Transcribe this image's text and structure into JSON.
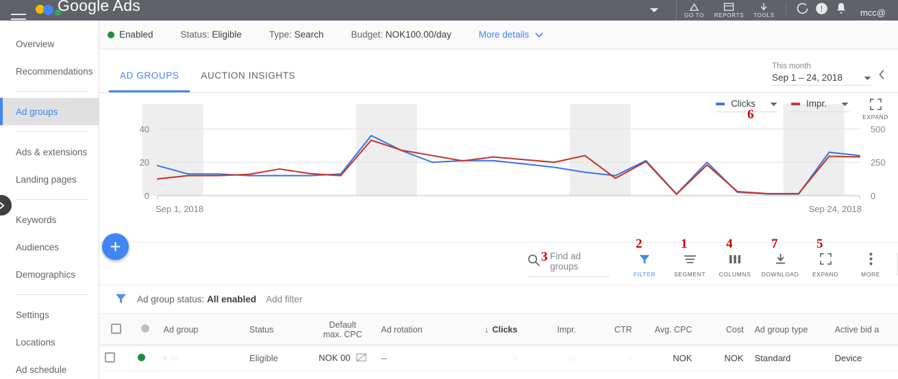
{
  "topbar": {
    "brand": "Google Ads",
    "menu_icon": "hamburger-icon",
    "account_caret": "chevron-down-icon",
    "tools": [
      {
        "label": "GO TO",
        "icon": "go-to-icon"
      },
      {
        "label": "REPORTS",
        "icon": "reports-icon"
      },
      {
        "label": "TOOLS",
        "icon": "tools-icon"
      }
    ],
    "refresh_icon": "refresh-icon",
    "help_icon": "help-icon",
    "notifications_icon": "bell-icon",
    "account": "mcc@"
  },
  "sidebar": {
    "items": [
      {
        "label": "Overview",
        "active": false
      },
      {
        "label": "Recommendations",
        "active": false
      },
      {
        "label": "Ad groups",
        "active": true
      },
      {
        "label": "Ads & extensions",
        "active": false
      },
      {
        "label": "Landing pages",
        "active": false
      },
      {
        "label": "Keywords",
        "active": false
      },
      {
        "label": "Audiences",
        "active": false
      },
      {
        "label": "Demographics",
        "active": false
      },
      {
        "label": "Settings",
        "active": false
      },
      {
        "label": "Locations",
        "active": false
      },
      {
        "label": "Ad schedule",
        "active": false
      }
    ],
    "expand_icon": "chevron-right-icon"
  },
  "statusbar": {
    "enabled_label": "Enabled",
    "status_label": "Status:",
    "status_value": "Eligible",
    "type_label": "Type:",
    "type_value": "Search",
    "budget_label": "Budget:",
    "budget_value": "NOK100.00/day",
    "more_details": "More details"
  },
  "tabs": [
    {
      "label": "AD GROUPS",
      "active": true
    },
    {
      "label": "AUCTION INSIGHTS",
      "active": false
    }
  ],
  "daterange": {
    "preset": "This month",
    "value": "Sep 1 – 24, 2018",
    "dropdown_icon": "caret-down-icon",
    "prev_icon": "chevron-left-icon"
  },
  "chart_legend": {
    "series1": {
      "label": "Clicks",
      "color": "#3b78e7"
    },
    "series2": {
      "label": "Impr.",
      "color": "#c5392e"
    },
    "expand_label": "EXPAND",
    "expand_icon": "expand-icon"
  },
  "toolbar": {
    "search_placeholder": "Find ad groups",
    "search_icon": "search-icon",
    "items": [
      {
        "label": "FILTER",
        "icon": "filter-icon",
        "active": true
      },
      {
        "label": "SEGMENT",
        "icon": "segment-icon",
        "active": false
      },
      {
        "label": "COLUMNS",
        "icon": "columns-icon",
        "active": false
      },
      {
        "label": "DOWNLOAD",
        "icon": "download-icon",
        "active": false
      },
      {
        "label": "EXPAND",
        "icon": "expand-icon",
        "active": false
      },
      {
        "label": "MORE",
        "icon": "more-vert-icon",
        "active": false
      }
    ]
  },
  "annotations": {
    "n1": "1",
    "n2": "2",
    "n3": "3",
    "n4": "4",
    "n5": "5",
    "n6": "6",
    "n7": "7",
    "color": "#cc0000"
  },
  "filterbar": {
    "filter_icon": "filter-icon",
    "chip_label": "Ad group status:",
    "chip_value": "All enabled",
    "add_filter": "Add filter"
  },
  "table": {
    "columns": [
      {
        "label": "",
        "key": "checkbox"
      },
      {
        "label": "",
        "key": "statusdot"
      },
      {
        "label": "Ad group",
        "key": "adgroup"
      },
      {
        "label": "Status",
        "key": "status"
      },
      {
        "label": "Default\nmax. CPC",
        "line1": "Default",
        "line2": "max. CPC",
        "key": "cpc"
      },
      {
        "label": "Ad rotation",
        "key": "rotation"
      },
      {
        "label": "Clicks",
        "key": "clicks",
        "sorted": true,
        "sort_icon": "arrow-down-icon"
      },
      {
        "label": "Impr.",
        "key": "impr"
      },
      {
        "label": "CTR",
        "key": "ctr"
      },
      {
        "label": "Avg. CPC",
        "key": "avgcpc"
      },
      {
        "label": "Cost",
        "key": "cost"
      },
      {
        "label": "Ad group type",
        "key": "type"
      },
      {
        "label": "Active bid a",
        "key": "activebid"
      }
    ],
    "rows": [
      {
        "status_dot": "enabled",
        "adgroup": "",
        "status": "Eligible",
        "cpc_currency": "NOK",
        "cpc_value": "00",
        "cpc_icon": "no-bid-icon",
        "rotation": "--",
        "clicks": "",
        "impr": "",
        "ctr": "",
        "avgcpc": "NOK",
        "cost": "NOK",
        "type": "Standard",
        "activebid": "Device"
      }
    ]
  },
  "fab": {
    "icon": "plus-icon",
    "label": ""
  },
  "chart_data": {
    "type": "line",
    "title": "",
    "xlabel": "",
    "ylabel": "Clicks",
    "y2label": "Impr.",
    "x_start_label": "Sep 1, 2018",
    "x_end_label": "Sep 24, 2018",
    "ylim": [
      0,
      50
    ],
    "y_ticks": [
      0,
      20,
      40
    ],
    "y2lim": [
      0,
      625
    ],
    "y2_ticks": [
      0,
      250,
      500
    ],
    "grid": true,
    "legend_position": "top-right",
    "x": [
      "Sep 1",
      "Sep 2",
      "Sep 3",
      "Sep 4",
      "Sep 5",
      "Sep 6",
      "Sep 7",
      "Sep 8",
      "Sep 9",
      "Sep 10",
      "Sep 11",
      "Sep 12",
      "Sep 13",
      "Sep 14",
      "Sep 15",
      "Sep 16",
      "Sep 17",
      "Sep 18",
      "Sep 19",
      "Sep 20",
      "Sep 21",
      "Sep 22",
      "Sep 23",
      "Sep 24"
    ],
    "weekend_bands": [
      [
        0,
        1
      ],
      [
        7,
        8
      ],
      [
        14,
        15
      ],
      [
        21,
        22
      ]
    ],
    "series": [
      {
        "name": "Clicks",
        "color": "#3b78e7",
        "axis": "left",
        "values": [
          18,
          13,
          13,
          12,
          12,
          12,
          13,
          36,
          27,
          20,
          21,
          21,
          19,
          17,
          14,
          12,
          21,
          1,
          20,
          2,
          1,
          1,
          26,
          24
        ]
      },
      {
        "name": "Impr.",
        "color": "#c5392e",
        "axis": "right",
        "values": [
          125,
          150,
          150,
          160,
          200,
          165,
          150,
          415,
          340,
          300,
          260,
          290,
          270,
          250,
          300,
          130,
          255,
          10,
          230,
          30,
          15,
          15,
          295,
          290
        ]
      }
    ]
  }
}
